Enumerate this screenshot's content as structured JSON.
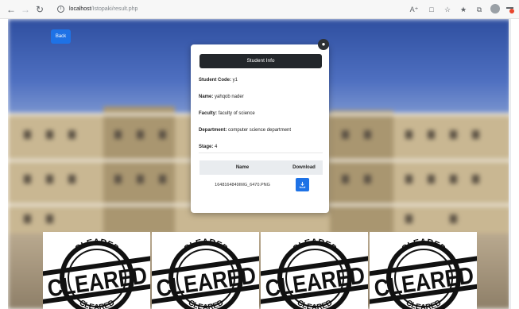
{
  "browser": {
    "url_host": "localhost",
    "url_path": "/Istopaki/result.php"
  },
  "page": {
    "back_label": "Back",
    "card": {
      "title": "Student Info",
      "fields": [
        {
          "label": "Student Code:",
          "value": "y1"
        },
        {
          "label": "Name:",
          "value": "yahqob nader"
        },
        {
          "label": "Faculty:",
          "value": "faculty of science"
        },
        {
          "label": "Department:",
          "value": "computer science department"
        },
        {
          "label": "Stage:",
          "value": "4"
        }
      ],
      "table": {
        "headers": [
          "Name",
          "Download"
        ],
        "rows": [
          {
            "name": "1648164849IMG_6470.PNG"
          }
        ]
      }
    },
    "stamps": [
      {
        "top": "CLEARED",
        "main": "CLEARED",
        "bottom": "CLEARED"
      },
      {
        "top": "CLEARED",
        "main": "CLEARED",
        "bottom": "CLEARED"
      },
      {
        "top": "CLEARED",
        "main": "CLEARED",
        "bottom": "CLEARED"
      },
      {
        "top": "CLEARED",
        "main": "CLEARED",
        "bottom": "CLEARED"
      }
    ]
  },
  "icons": {
    "back": "arrow-left-icon",
    "forward": "arrow-right-icon",
    "reload": "reload-icon",
    "site_info": "info-icon",
    "user": "user-icon",
    "download": "download-icon"
  },
  "colors": {
    "primary": "#1e72e6",
    "dark_header": "#23272b",
    "stamp": "#111111"
  }
}
